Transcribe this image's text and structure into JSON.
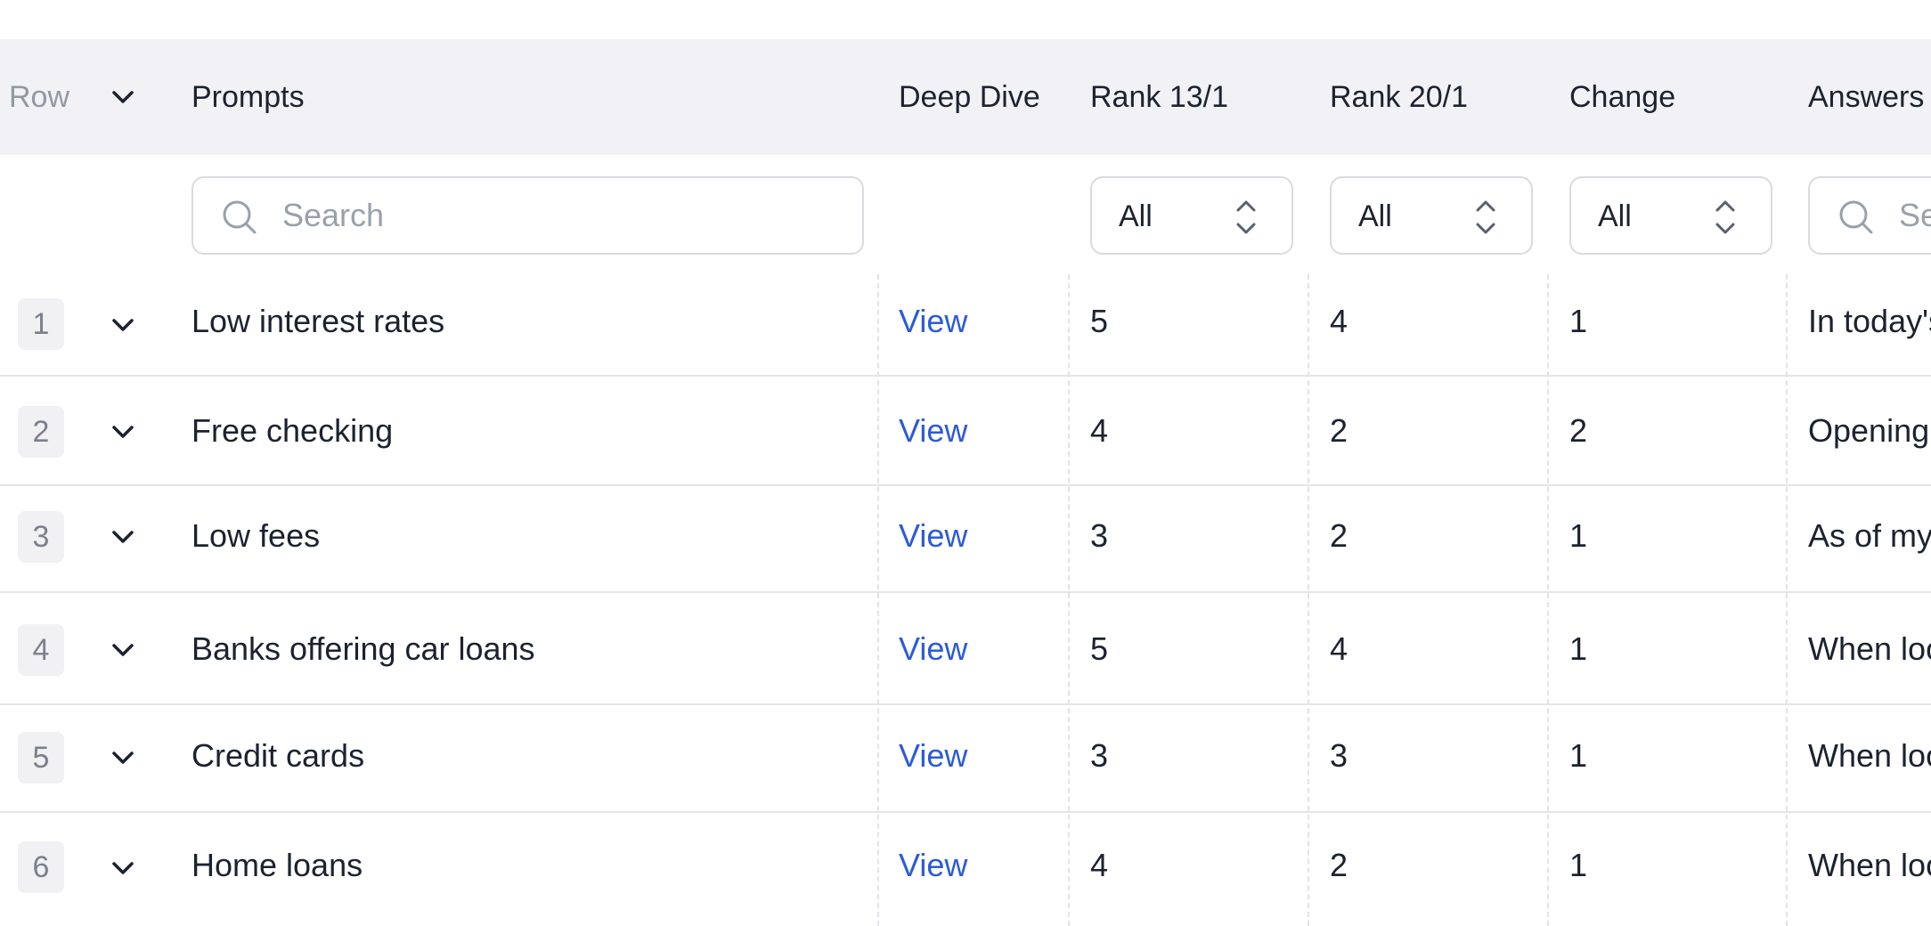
{
  "header": {
    "row_label": "Row",
    "prompts_label": "Prompts",
    "deep_dive_label": "Deep Dive",
    "rank_a_label": "Rank 13/1",
    "rank_b_label": "Rank 20/1",
    "change_label": "Change",
    "answers_label": "Answers"
  },
  "filters": {
    "prompts_search_placeholder": "Search",
    "rank_a_value": "All",
    "rank_b_value": "All",
    "change_value": "All",
    "answers_search_placeholder": "Search"
  },
  "rows": [
    {
      "num": "1",
      "prompt": "Low interest rates",
      "link": "View",
      "rank_a": "5",
      "rank_b": "4",
      "change": "1",
      "answer": "In today's"
    },
    {
      "num": "2",
      "prompt": "Free checking",
      "link": "View",
      "rank_a": "4",
      "rank_b": "2",
      "change": "2",
      "answer": "Opening a"
    },
    {
      "num": "3",
      "prompt": "Low fees",
      "link": "View",
      "rank_a": "3",
      "rank_b": "2",
      "change": "1",
      "answer": "As of my"
    },
    {
      "num": "4",
      "prompt": "Banks offering car loans",
      "link": "View",
      "rank_a": "5",
      "rank_b": "4",
      "change": "1",
      "answer": "When look"
    },
    {
      "num": "5",
      "prompt": "Credit cards",
      "link": "View",
      "rank_a": "3",
      "rank_b": "3",
      "change": "1",
      "answer": "When look"
    },
    {
      "num": "6",
      "prompt": "Home loans",
      "link": "View",
      "rank_a": "4",
      "rank_b": "2",
      "change": "1",
      "answer": "When look"
    }
  ],
  "icons": {
    "header_expand": "chevron-down-icon",
    "row_expand": "chevron-down-icon",
    "search": "search-icon",
    "select": "up-down-arrows-icon"
  },
  "colors": {
    "header_bg": "#f2f2f6",
    "link": "#2c5bd6",
    "border": "#e4e5ea"
  }
}
